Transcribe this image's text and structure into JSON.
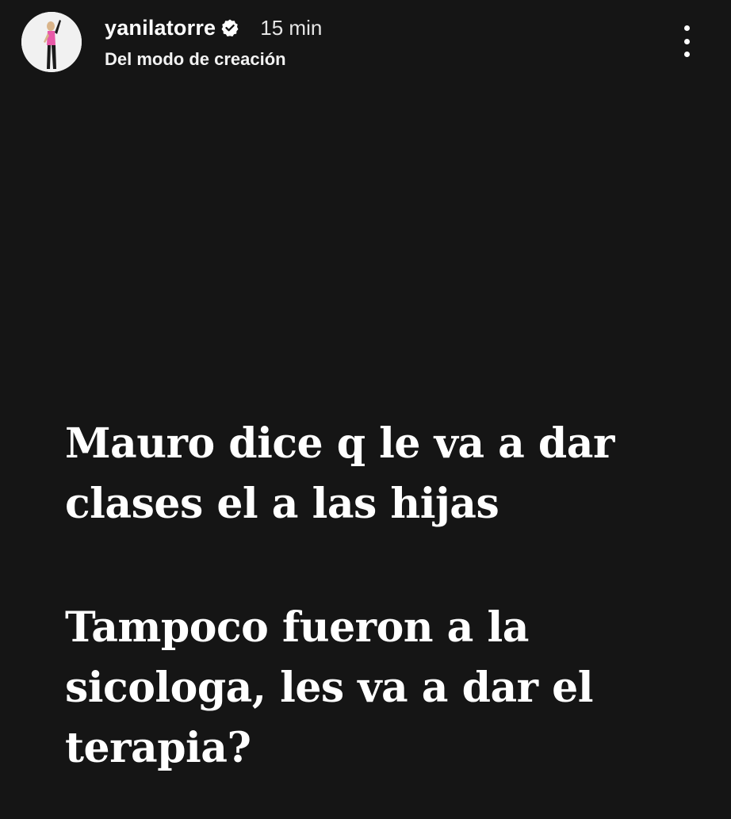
{
  "header": {
    "username": "yanilatorre",
    "verified_icon": "verified-badge-icon",
    "time": "15 min",
    "subtitle": "Del modo de creación",
    "more_icon": "more-vertical-icon"
  },
  "story": {
    "paragraph1": "Mauro dice q le va a dar clases el a las hijas",
    "paragraph2": "Tampoco fueron a la sicologa, les va a dar el terapia?"
  },
  "colors": {
    "background": "#151515",
    "text": "#ffffff",
    "avatar_bg": "#f1f1f1",
    "avatar_outfit": "#e85aa8"
  }
}
